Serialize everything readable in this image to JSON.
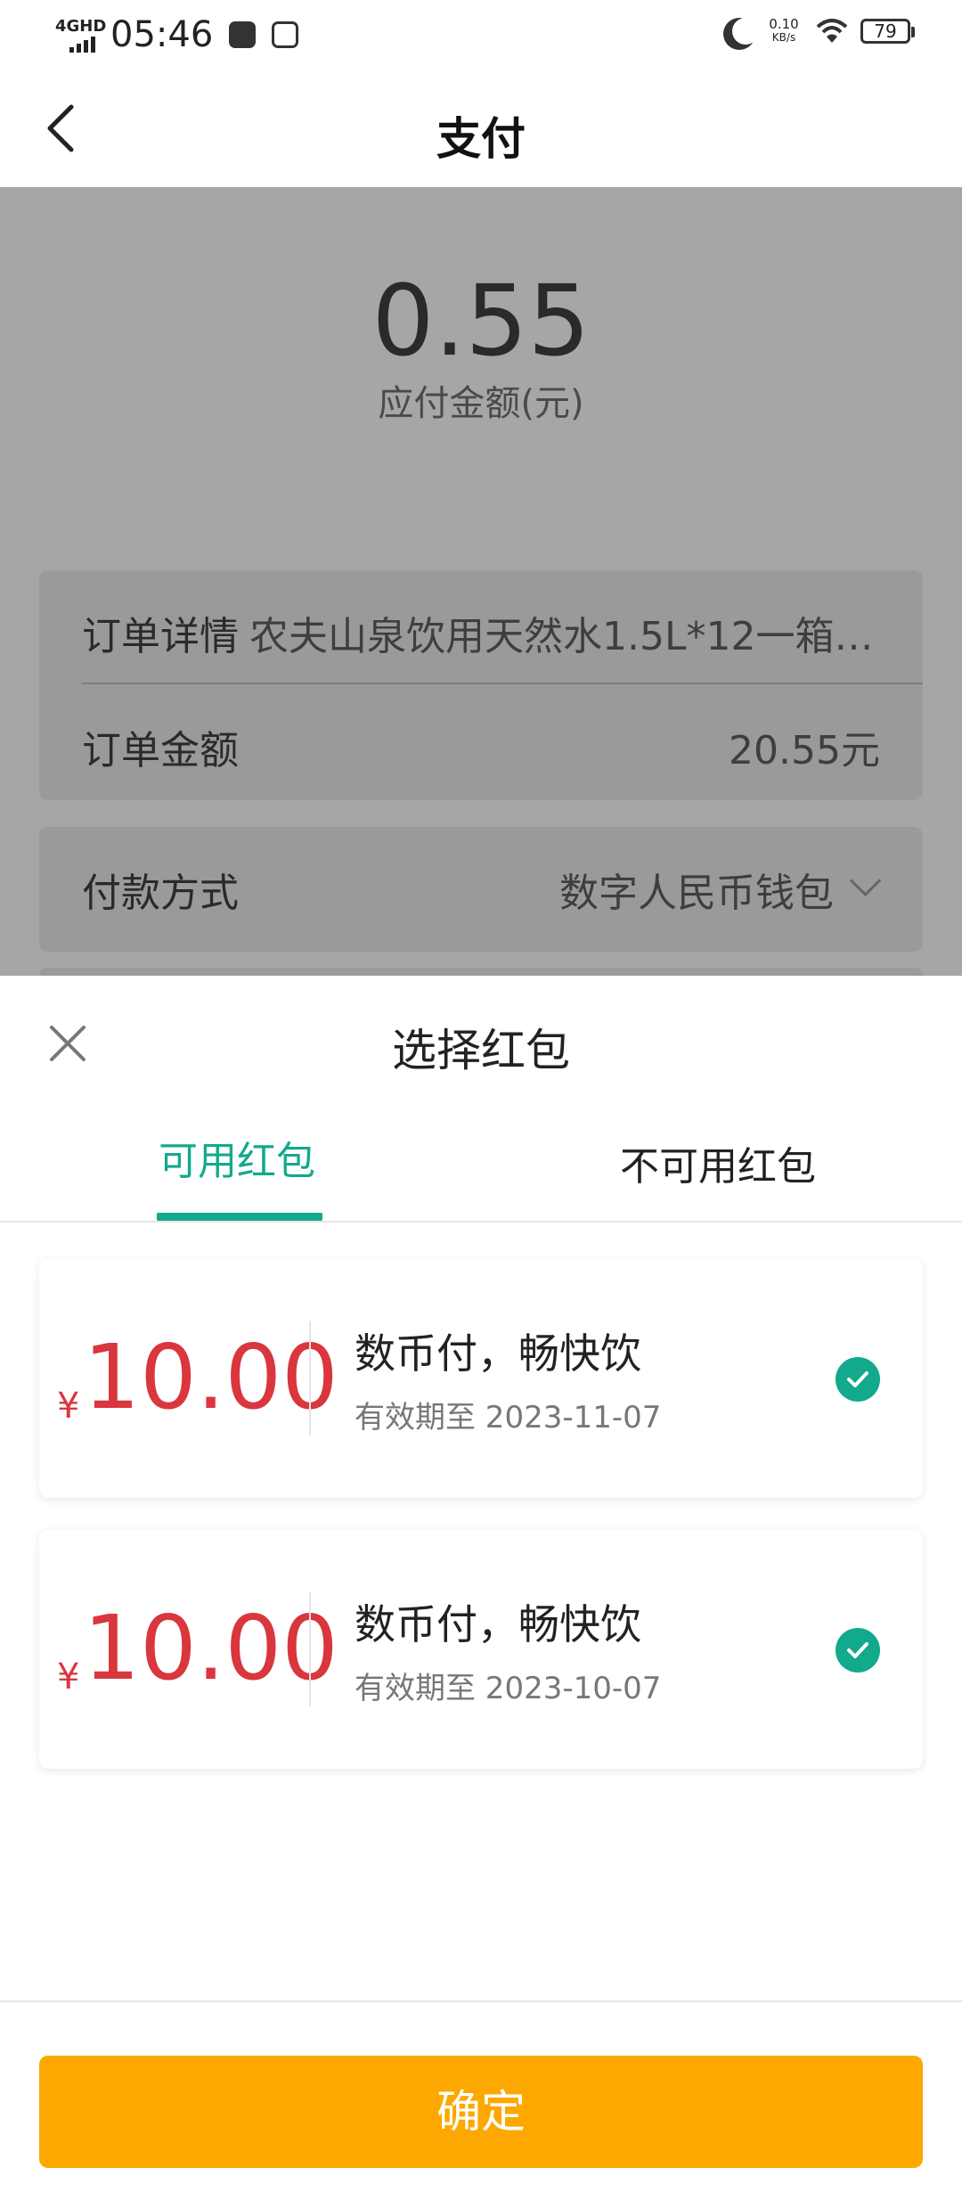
{
  "status_bar": {
    "network": "4GHD",
    "time": "05:46",
    "speed_value": "0.10",
    "speed_unit": "KB/s",
    "battery": "79"
  },
  "nav": {
    "title": "支付"
  },
  "payment": {
    "amount": "0.55",
    "amount_label": "应付金额(元)",
    "order_detail_label": "订单详情",
    "order_detail_value": "农夫山泉饮用天然水1.5L*12一箱…",
    "order_amount_label": "订单金额",
    "order_amount_value": "20.55元",
    "pay_method_label": "付款方式",
    "pay_method_value": "数字人民币钱包"
  },
  "sheet": {
    "title": "选择红包",
    "tabs": [
      {
        "label": "可用红包",
        "active": true
      },
      {
        "label": "不可用红包",
        "active": false
      }
    ],
    "coupons": [
      {
        "currency": "¥",
        "amount": "10.00",
        "name": "数币付，畅快饮",
        "expiry": "有效期至 2023-11-07",
        "selected": true
      },
      {
        "currency": "¥",
        "amount": "10.00",
        "name": "数币付，畅快饮",
        "expiry": "有效期至 2023-10-07",
        "selected": true
      }
    ],
    "confirm_label": "确定"
  },
  "colors": {
    "accent": "#12a98c",
    "coupon_amount": "#d9363e",
    "confirm": "#fca800"
  }
}
